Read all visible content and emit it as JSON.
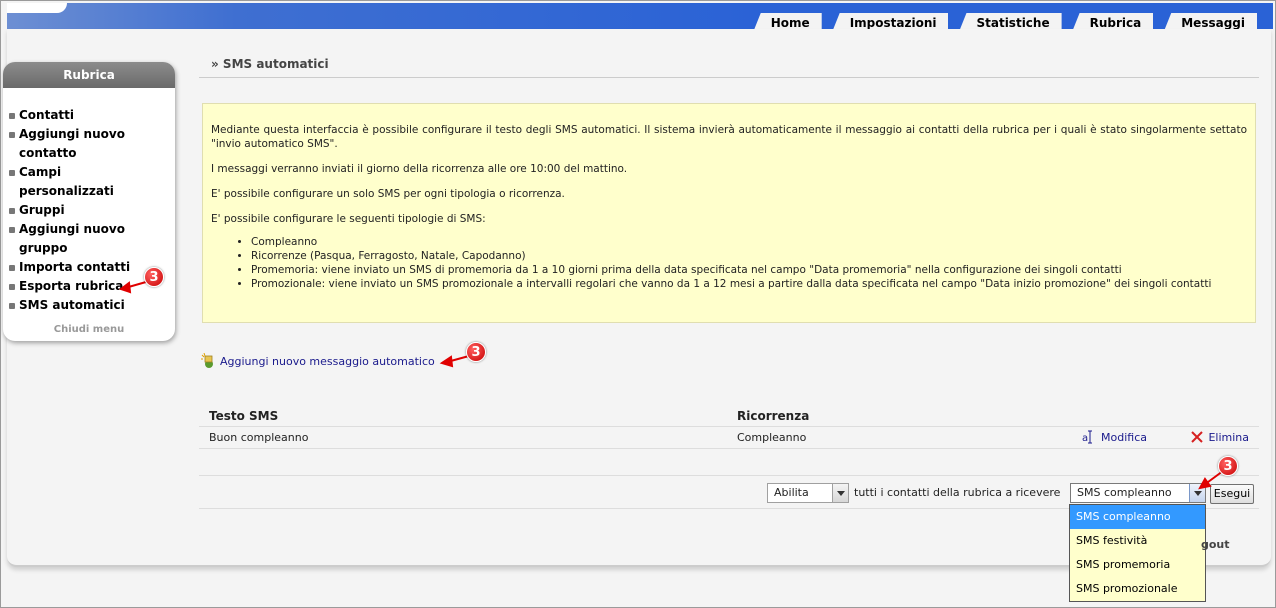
{
  "nav": {
    "tabs": [
      {
        "label": "Home"
      },
      {
        "label": "Impostazioni"
      },
      {
        "label": "Statistiche"
      },
      {
        "label": "Rubrica"
      },
      {
        "label": "Messaggi"
      }
    ]
  },
  "sidebar": {
    "title": "Rubrica",
    "items": [
      {
        "label": "Contatti"
      },
      {
        "label": "Aggiungi nuovo contatto"
      },
      {
        "label": "Campi personalizzati"
      },
      {
        "label": "Gruppi"
      },
      {
        "label": "Aggiungi nuovo gruppo"
      },
      {
        "label": "Importa contatti"
      },
      {
        "label": "Esporta rubrica"
      },
      {
        "label": "SMS automatici"
      }
    ],
    "close_label": "Chiudi menu"
  },
  "page": {
    "title": "» SMS automatici"
  },
  "info": {
    "p1": "Mediante questa interfaccia è possibile configurare il testo degli SMS automatici. Il sistema invierà automaticamente il messaggio ai contatti della rubrica per i quali è stato singolarmente settato \"invio automatico SMS\".",
    "p2": "I messaggi verranno inviati il giorno della ricorrenza alle ore 10:00 del mattino.",
    "p3": "E' possibile configurare un solo SMS per ogni tipologia o ricorrenza.",
    "p4": "E' possibile configurare le seguenti tipologie di SMS:",
    "types": [
      "Compleanno",
      "Ricorrenze (Pasqua, Ferragosto, Natale, Capodanno)",
      "Promemoria: viene inviato un SMS di promemoria da 1 a 10 giorni prima della data specificata nel campo \"Data promemoria\" nella configurazione dei singoli contatti",
      "Promozionale: viene inviato un SMS promozionale a intervalli regolari che vanno da 1 a 12 mesi a partire dalla data specificata nel campo \"Data inizio promozione\" dei singoli contatti"
    ]
  },
  "add_link": "Aggiungi nuovo messaggio automatico",
  "table": {
    "headers": {
      "text": "Testo SMS",
      "recurrence": "Ricorrenza"
    },
    "rows": [
      {
        "text": "Buon compleanno",
        "recurrence": "Compleanno",
        "edit": "Modifica",
        "delete": "Elimina"
      }
    ]
  },
  "actions": {
    "action_value": "Abilita",
    "middle_text": "tutti i contatti della rubrica a ricevere",
    "type_value": "SMS compleanno",
    "exec_label": "Esegui",
    "options": [
      "SMS compleanno",
      "SMS festività",
      "SMS promemoria",
      "SMS promozionale"
    ]
  },
  "logout_fragment": "gout",
  "markers": {
    "label": "3"
  }
}
